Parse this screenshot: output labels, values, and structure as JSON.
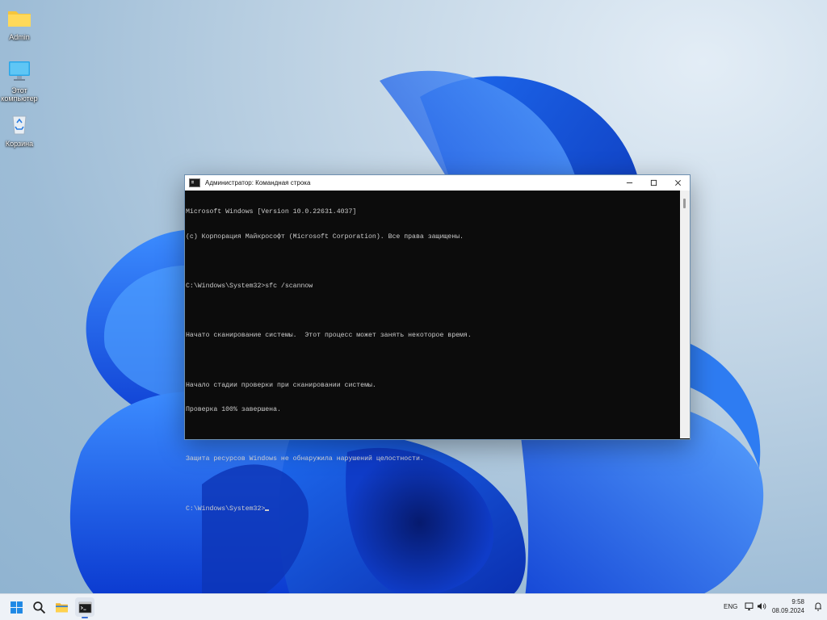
{
  "desktop": {
    "icons": [
      {
        "label": "Admin",
        "icon": "folder-icon"
      },
      {
        "label": "Этот компьютер",
        "icon": "monitor-icon"
      },
      {
        "label": "Корзина",
        "icon": "recycle-bin-icon"
      }
    ]
  },
  "window": {
    "title": "Администратор: Командная строка",
    "controls": [
      "minimize-icon",
      "maximize-icon",
      "close-icon"
    ],
    "console_lines": [
      "Microsoft Windows [Version 10.0.22631.4037]",
      "(c) Корпорация Майкрософт (Microsoft Corporation). Все права защищены.",
      "",
      "C:\\Windows\\System32>sfc /scannow",
      "",
      "Начато сканирование системы.  Этот процесс может занять некоторое время.",
      "",
      "Начало стадии проверки при сканировании системы.",
      "Проверка 100% завершена.",
      "",
      "Защита ресурсов Windows не обнаружила нарушений целостности.",
      "",
      "C:\\Windows\\System32>"
    ]
  },
  "taskbar": {
    "items": [
      "windows-start-icon",
      "search-icon",
      "file-explorer-icon",
      "terminal-icon"
    ],
    "language": "ENG",
    "time": "9:58",
    "date": "08.09.2024",
    "colors": {
      "accent": "#3a6fd4"
    }
  }
}
